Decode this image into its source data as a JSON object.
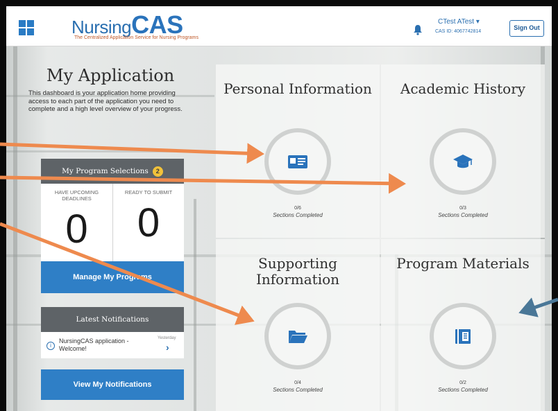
{
  "header": {
    "logo_prefix": "Nursing",
    "logo_suffix": "CAS",
    "tagline": "The Centralized Application Service for Nursing Programs",
    "user_name": "CTest ATest ▾",
    "user_id": "CAS ID: 4067742814",
    "sign_out_label": "Sign Out"
  },
  "sidebar": {
    "title": "My Application",
    "description": "This dashboard is your application home providing access to each part of the application you need to complete and a high level overview of your progress.",
    "program_selections": {
      "heading": "My Program Selections",
      "badge": "2",
      "upcoming_label": "HAVE UPCOMING DEADLINES",
      "upcoming_count": "0",
      "ready_label": "READY TO SUBMIT",
      "ready_count": "0",
      "manage_button": "Manage My Programs"
    },
    "notifications": {
      "heading": "Latest Notifications",
      "item_text": "NursingCAS application - Welcome!",
      "item_time": "Yesterday",
      "view_button": "View My Notifications"
    }
  },
  "cards": [
    {
      "title": "Personal Information",
      "count": "0/6",
      "label": "Sections Completed",
      "icon": "id-card-icon"
    },
    {
      "title": "Academic History",
      "count": "0/3",
      "label": "Sections Completed",
      "icon": "graduation-cap-icon"
    },
    {
      "title": "Supporting Information",
      "count": "0/4",
      "label": "Sections Completed",
      "icon": "folder-icon"
    },
    {
      "title": "Program Materials",
      "count": "0/2",
      "label": "Sections Completed",
      "icon": "book-icon"
    }
  ],
  "colors": {
    "brand_blue": "#2f7fc6",
    "dark_panel": "#5e6367",
    "badge_yellow": "#f2c23a",
    "annotation_arrow_orange": "#ee8a4e",
    "annotation_arrow_blue": "#4a7797"
  }
}
